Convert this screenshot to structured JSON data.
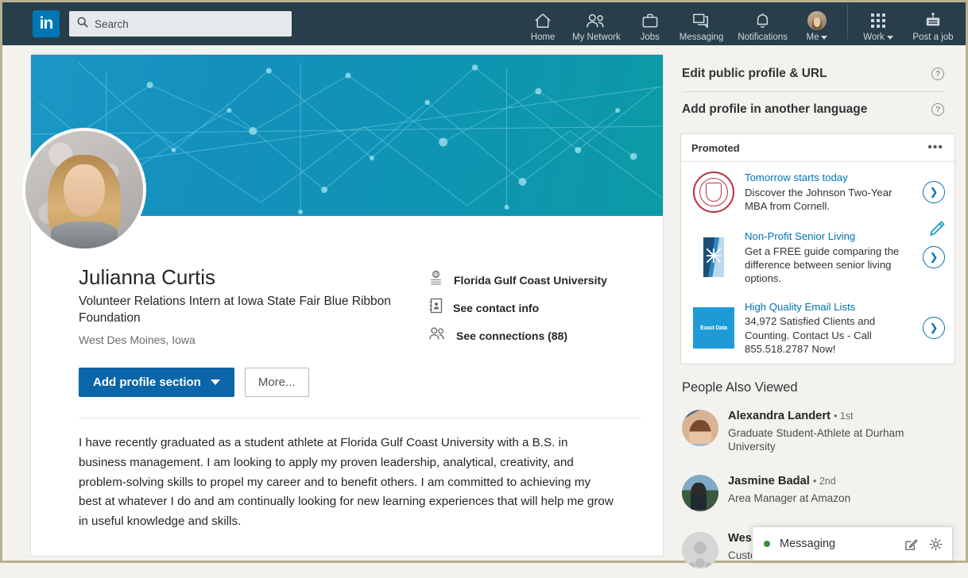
{
  "nav": {
    "logo_text": "in",
    "logo_name": "linkedin-logo",
    "search": {
      "placeholder": "Search",
      "value": "",
      "icon": "search-icon"
    },
    "items": [
      {
        "label": "Home",
        "icon": "home-icon"
      },
      {
        "label": "My Network",
        "icon": "people-icon"
      },
      {
        "label": "Jobs",
        "icon": "briefcase-icon"
      },
      {
        "label": "Messaging",
        "icon": "message-bubble-icon"
      },
      {
        "label": "Notifications",
        "icon": "bell-icon"
      },
      {
        "label": "Me",
        "icon": "avatar-icon",
        "has_caret": true
      }
    ],
    "right_items": [
      {
        "label": "Work",
        "icon": "grid-dots-icon",
        "has_caret": true
      },
      {
        "label": "Post a job",
        "icon": "post-job-icon"
      }
    ]
  },
  "profile": {
    "name": "Julianna Curtis",
    "headline": "Volunteer Relations Intern at Iowa State Fair Blue Ribbon Foundation",
    "location": "West Des Moines, Iowa",
    "edit_icon": "pencil-icon",
    "info_rows": [
      {
        "icon": "university-crest-icon",
        "text": "Florida Gulf Coast University"
      },
      {
        "icon": "contact-card-icon",
        "text": "See contact info"
      },
      {
        "icon": "connections-icon",
        "text": "See connections (88)"
      }
    ],
    "buttons": {
      "primary": "Add profile section",
      "secondary": "More..."
    },
    "summary": "I have recently graduated as a student athlete at Florida Gulf Coast University with a B.S. in business management. I am looking to apply my proven leadership, analytical, creativity, and problem-solving skills to propel my career and to benefit others. I am committed to achieving my best at whatever I do and am continually looking for new learning experiences that will help me grow in useful knowledge and skills."
  },
  "sidebar": {
    "links": [
      {
        "label": "Edit public profile & URL",
        "icon": "help-circle-icon"
      },
      {
        "label": "Add profile in another language",
        "icon": "help-circle-icon"
      }
    ],
    "promoted": {
      "title": "Promoted",
      "overflow_icon": "ellipsis-icon",
      "ads": [
        {
          "logo": "cornell-seal-icon",
          "title": "Tomorrow starts today",
          "desc": "Discover the Johnson Two-Year MBA from Cornell.",
          "arrow": "chevron-right-icon"
        },
        {
          "logo": "senior-living-icon",
          "title": "Non-Profit Senior Living",
          "desc": "Get a FREE guide comparing the difference between senior living options.",
          "arrow": "chevron-right-icon"
        },
        {
          "logo": "exact-data-icon",
          "logo_text": "Exact Data",
          "title": "High Quality Email Lists",
          "desc": "34,972 Satisfied Clients and Counting. Contact Us - Call 855.518.2787 Now!",
          "arrow": "chevron-right-icon"
        }
      ]
    },
    "people_also_viewed": {
      "title": "People Also Viewed",
      "people": [
        {
          "name": "Alexandra Landert",
          "degree": "1st",
          "subtitle": "Graduate Student-Athlete at Durham University",
          "avatar": "alexandra-avatar"
        },
        {
          "name": "Jasmine Badal",
          "degree": "2nd",
          "subtitle": "Area Manager at Amazon",
          "avatar": "jasmine-avatar"
        },
        {
          "name": "Wesl",
          "degree": "",
          "subtitle": "Custo",
          "avatar": "generic-avatar"
        }
      ]
    }
  },
  "messaging_bar": {
    "label": "Messaging",
    "status": "online",
    "compose_icon": "compose-icon",
    "settings_icon": "gear-icon"
  },
  "colors": {
    "nav_bg": "#283e4a",
    "brand_blue": "#0077b5",
    "primary_button": "#0a66a8",
    "link_blue": "#0073b1",
    "banner_start": "#1a97c4",
    "banner_end": "#0c9aa6",
    "page_bg": "#f3f2ef",
    "status_green": "#3a8e3a"
  }
}
